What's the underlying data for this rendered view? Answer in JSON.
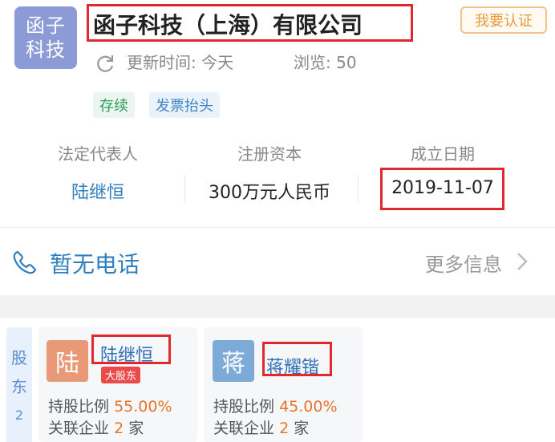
{
  "company": {
    "logo_text": [
      "函子",
      "科技"
    ],
    "name": "函子科技（上海）有限公司",
    "claim_label": "我要认证",
    "update_label": "更新时间: 今天",
    "views_label": "浏览: 50"
  },
  "tags": {
    "status": "存续",
    "invoice": "发票抬头"
  },
  "info": {
    "legal_rep_label": "法定代表人",
    "legal_rep_value": "陆继恒",
    "capital_label": "注册资本",
    "capital_value": "300万元人民币",
    "founded_label": "成立日期",
    "founded_value": "2019-11-07"
  },
  "contact": {
    "phone_text": "暂无电话",
    "more_info": "更多信息"
  },
  "shareholders": {
    "tab_chars": [
      "股",
      "东",
      "2"
    ],
    "items": [
      {
        "avatar_char": "陆",
        "avatar_color": "#e89a78",
        "name": "陆继恒",
        "badge": "大股东",
        "ratio_label": "持股比例",
        "ratio_value": "55.00%",
        "related_label": "关联企业",
        "related_count": "2",
        "related_unit": "家"
      },
      {
        "avatar_char": "蒋",
        "avatar_color": "#7eaad8",
        "name": "蒋耀锴",
        "ratio_label": "持股比例",
        "ratio_value": "45.00%",
        "related_label": "关联企业",
        "related_count": "2",
        "related_unit": "家"
      }
    ]
  },
  "colors": {
    "accent_blue": "#2f7fc0",
    "highlight_red": "#e0282e",
    "orange": "#e8742c"
  }
}
